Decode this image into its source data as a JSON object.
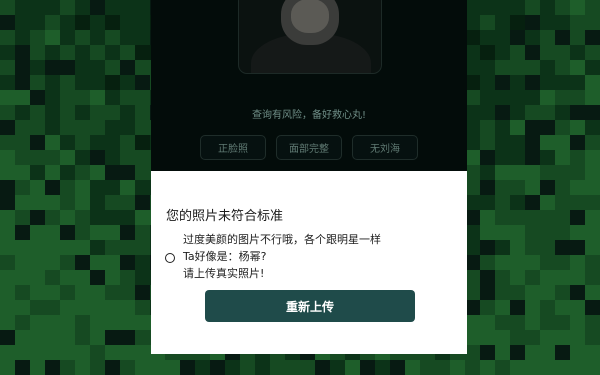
{
  "background": {
    "palette": [
      "#031109",
      "#06200f",
      "#0c3318",
      "#164a22",
      "#1e5e2a",
      "#071a12"
    ],
    "accent": "#1f4b4a"
  },
  "app_card": {
    "warning_text": "查询有风险，备好救心丸!",
    "tags": [
      "正脸照",
      "面部完整",
      "无刘海"
    ]
  },
  "dialog": {
    "title": "您的照片未符合标准",
    "reason_lines": [
      "过度美颜的图片不行哦，各个跟明星一样",
      "Ta好像是：杨幂?",
      "请上传真实照片!"
    ],
    "button_label": "重新上传"
  }
}
